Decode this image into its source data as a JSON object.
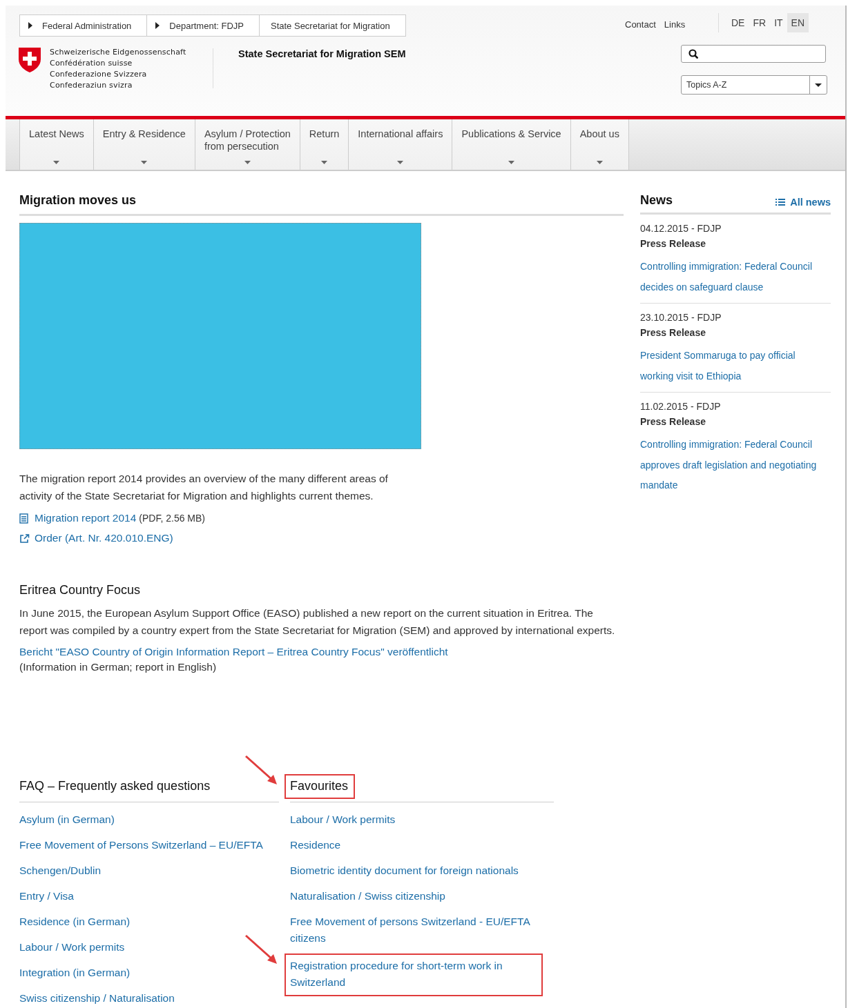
{
  "breadcrumbs": [
    {
      "label": "Federal Administration",
      "arrow": true
    },
    {
      "label": "Department: FDJP",
      "arrow": true
    },
    {
      "label": "State Secretariat for Migration",
      "arrow": false
    }
  ],
  "logo": {
    "lines": [
      "Schweizerische Eidgenossenschaft",
      "Confédération suisse",
      "Confederazione Svizzera",
      "Confederaziun svizra"
    ]
  },
  "site_title": "State Secretariat for Migration SEM",
  "service_links": [
    "Contact",
    "Links"
  ],
  "languages": [
    {
      "label": "DE",
      "selected": false
    },
    {
      "label": "FR",
      "selected": false
    },
    {
      "label": "IT",
      "selected": false
    },
    {
      "label": "EN",
      "selected": true
    }
  ],
  "topics_select": {
    "value": "Topics A-Z"
  },
  "nav": [
    {
      "lines": [
        "Latest News"
      ]
    },
    {
      "lines": [
        "Entry & Residence"
      ]
    },
    {
      "lines": [
        "Asylum / Protection",
        "from persecution"
      ]
    },
    {
      "lines": [
        "Return"
      ]
    },
    {
      "lines": [
        "International affairs"
      ]
    },
    {
      "lines": [
        "Publications & Service"
      ]
    },
    {
      "lines": [
        "About us"
      ]
    }
  ],
  "main": {
    "heading": "Migration moves us",
    "text": "The migration report 2014 provides an overview of the many different areas of activity of the State Secretariat for Migration and highlights current themes.",
    "links": [
      {
        "kind": "pdf",
        "label": "Migration report 2014",
        "note": "(PDF, 2.56 MB)"
      },
      {
        "kind": "external",
        "label": "Order (Art. Nr. 420.010.ENG)"
      }
    ]
  },
  "focus": {
    "heading": "Eritrea Country Focus",
    "text": "In June 2015, the European Asylum Support Office (EASO) published a new report on the current situation in Eritrea. The report was compiled by a country expert from the State Secretariat for Migration (SEM) and approved by international experts.",
    "link": "Bericht \"EASO Country of Origin Information Report – Eritrea Country Focus\" veröffentlicht",
    "note": "(Information in German; report in English)"
  },
  "news": {
    "heading": "News",
    "all_link": "All news",
    "items": [
      {
        "date": "04.12.2015 - FDJP",
        "type": "Press Release",
        "title": "Controlling immigration: Federal Council decides on safeguard clause"
      },
      {
        "date": "23.10.2015 - FDJP",
        "type": "Press Release",
        "title": "President Sommaruga to pay official working visit to Ethiopia"
      },
      {
        "date": "11.02.2015 - FDJP",
        "type": "Press Release",
        "title": "Controlling immigration: Federal Council approves draft legislation and negotiating mandate"
      }
    ]
  },
  "faq": {
    "heading": "FAQ – Frequently asked questions",
    "items": [
      "Asylum (in German)",
      "Free Movement of Persons Switzerland – EU/EFTA",
      "Schengen/Dublin",
      "Entry / Visa",
      "Residence (in German)",
      "Labour / Work permits",
      "Integration (in German)",
      "Swiss citizenship / Naturalisation"
    ]
  },
  "favourites": {
    "heading": "Favourites",
    "highlighted": true,
    "items": [
      {
        "label": "Labour / Work permits",
        "highlighted": false
      },
      {
        "label": "Residence",
        "highlighted": false
      },
      {
        "label": "Biometric identity document for foreign nationals",
        "highlighted": false
      },
      {
        "label": "Naturalisation / Swiss citizenship",
        "highlighted": false
      },
      {
        "label": "Free Movement of persons Switzerland - EU/EFTA citizens",
        "highlighted": false
      },
      {
        "label": "Registration procedure for short-term work in Switzerland",
        "highlighted": true
      }
    ]
  }
}
